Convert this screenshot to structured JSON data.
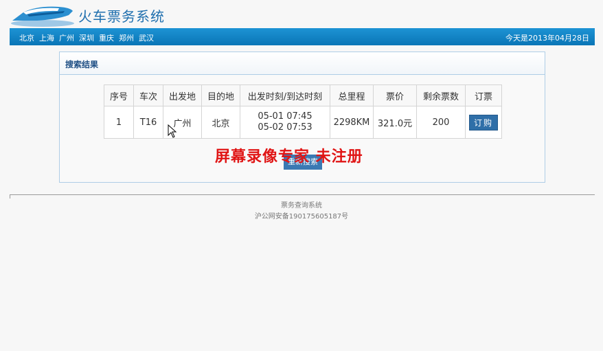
{
  "header": {
    "title": "火车票务系统",
    "nav_links": [
      "北京",
      "上海",
      "广州",
      "深圳",
      "重庆",
      "郑州",
      "武汉"
    ],
    "date_text": "今天是2013年04月28日"
  },
  "panel": {
    "title": "搜索结果",
    "table": {
      "columns": [
        "序号",
        "车次",
        "出发地",
        "目的地",
        "出发时刻/到达时刻",
        "总里程",
        "票价",
        "剩余票数",
        "订票"
      ],
      "rows": [
        {
          "index": "1",
          "train": "T16",
          "from": "广州",
          "to": "北京",
          "depart": "05-01 07:45",
          "arrive": "05-02 07:53",
          "distance": "2298KM",
          "price": "321.0元",
          "remaining": "200",
          "book_label": "订购"
        }
      ]
    },
    "retry_label": "重新搜索",
    "watermark": "屏幕录像专家 未注册"
  },
  "footer": {
    "line1": "票务查询系统",
    "line2": "沪公网安备190175605187号"
  },
  "colors": {
    "nav_bar": "#0a75b6",
    "title_blue": "#1f6fae",
    "button_blue": "#2f6fa8",
    "watermark_red": "#e01515"
  },
  "icons": [
    "train-logo-icon",
    "mouse-cursor-icon"
  ]
}
